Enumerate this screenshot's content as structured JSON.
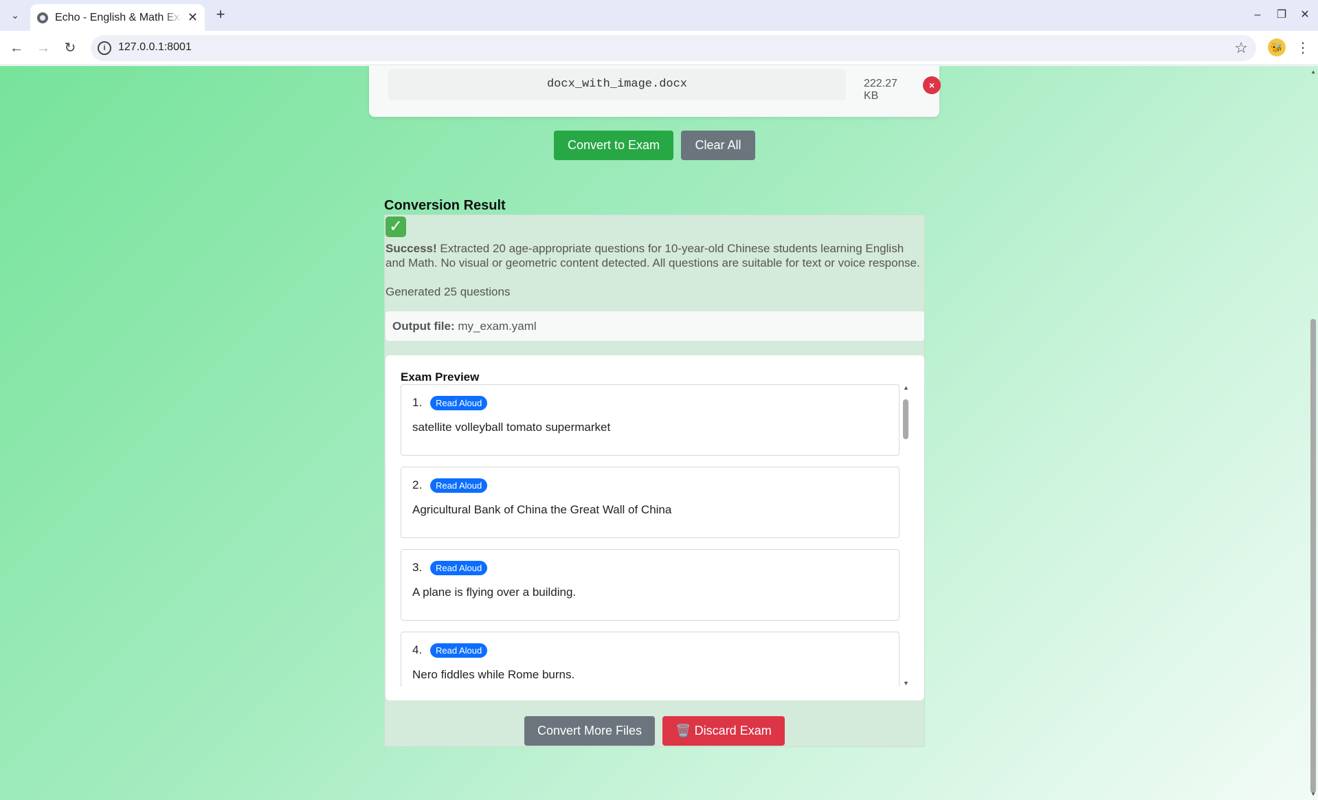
{
  "browser": {
    "tab_title": "Echo - English & Math Exam",
    "url": "127.0.0.1:8001"
  },
  "upload": {
    "file_name": "docx_with_image.docx",
    "file_size": "222.27 KB"
  },
  "actions": {
    "convert_label": "Convert to Exam",
    "clear_label": "Clear All"
  },
  "result": {
    "heading": "Conversion Result",
    "success_label": "Success!",
    "success_message": "Extracted 20 age-appropriate questions for 10-year-old Chinese students learning English and Math. No visual or geometric content detected. All questions are suitable for text or voice response.",
    "generated": "Generated 25 questions",
    "output_label": "Output file:",
    "output_file": "my_exam.yaml"
  },
  "preview": {
    "title": "Exam Preview",
    "questions": [
      {
        "num": "1.",
        "badge": "Read Aloud",
        "text": "satellite volleyball tomato supermarket"
      },
      {
        "num": "2.",
        "badge": "Read Aloud",
        "text": "Agricultural Bank of China the Great Wall of China"
      },
      {
        "num": "3.",
        "badge": "Read Aloud",
        "text": "A plane is flying over a building."
      },
      {
        "num": "4.",
        "badge": "Read Aloud",
        "text": "Nero fiddles while Rome burns."
      }
    ]
  },
  "footer_actions": {
    "more_label": "Convert More Files",
    "discard_label": "🗑️ Discard Exam"
  },
  "colors": {
    "success_green": "#28a745",
    "secondary_gray": "#6c757d",
    "danger_red": "#dc3545",
    "badge_blue": "#0d6efd"
  }
}
